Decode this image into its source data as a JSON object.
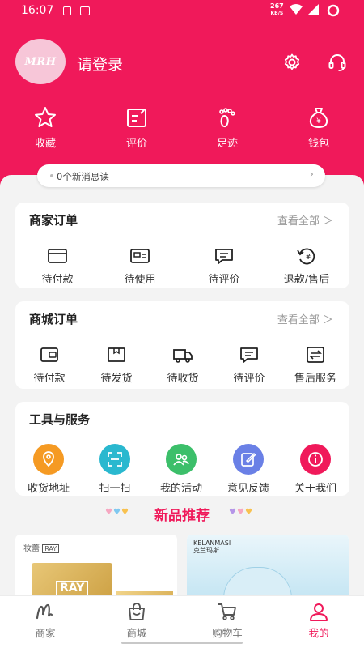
{
  "status_bar": {
    "time": "16:07",
    "net_speed_value": "267",
    "net_speed_unit": "KB/S"
  },
  "profile": {
    "avatar_text": "MRH",
    "login_label": "请登录"
  },
  "quick_actions": [
    {
      "label": "收藏",
      "icon": "star-icon"
    },
    {
      "label": "评价",
      "icon": "edit-note-icon"
    },
    {
      "label": "足迹",
      "icon": "footprint-icon"
    },
    {
      "label": "钱包",
      "icon": "wallet-bag-icon"
    }
  ],
  "message_bar": {
    "text": "0个新消息读"
  },
  "merchant_orders": {
    "title": "商家订单",
    "more": "查看全部 ＞",
    "items": [
      {
        "label": "待付款",
        "icon": "card-icon"
      },
      {
        "label": "待使用",
        "icon": "ticket-icon"
      },
      {
        "label": "待评价",
        "icon": "comment-icon"
      },
      {
        "label": "退款/售后",
        "icon": "refund-icon"
      }
    ]
  },
  "mall_orders": {
    "title": "商城订单",
    "more": "查看全部 ＞",
    "items": [
      {
        "label": "待付款",
        "icon": "wallet-icon"
      },
      {
        "label": "待发货",
        "icon": "box-icon"
      },
      {
        "label": "待收货",
        "icon": "truck-icon"
      },
      {
        "label": "待评价",
        "icon": "comment-icon"
      },
      {
        "label": "售后服务",
        "icon": "exchange-icon"
      }
    ]
  },
  "tools": {
    "title": "工具与服务",
    "items": [
      {
        "label": "收货地址",
        "icon": "location-icon",
        "color": "#f59a23"
      },
      {
        "label": "扫一扫",
        "icon": "scan-icon",
        "color": "#2ab8cf"
      },
      {
        "label": "我的活动",
        "icon": "people-icon",
        "color": "#3cbf6a"
      },
      {
        "label": "意见反馈",
        "icon": "feedback-icon",
        "color": "#6a80e6"
      },
      {
        "label": "关于我们",
        "icon": "info-icon",
        "color": "#f0195a"
      }
    ]
  },
  "new_products": {
    "title": "新品推荐",
    "p1_brand": "妆蕾",
    "p1_brand_en": "RAY",
    "p2_brand": "KELANMASI",
    "p2_brand_cn": "克兰玛斯"
  },
  "bottom_nav": [
    {
      "label": "商家",
      "icon": "merchant-m-icon"
    },
    {
      "label": "商城",
      "icon": "shopping-bag-icon"
    },
    {
      "label": "购物车",
      "icon": "cart-icon"
    },
    {
      "label": "我的",
      "icon": "person-icon"
    }
  ],
  "colors": {
    "brand": "#f0195a",
    "background": "#f3f3f3"
  }
}
